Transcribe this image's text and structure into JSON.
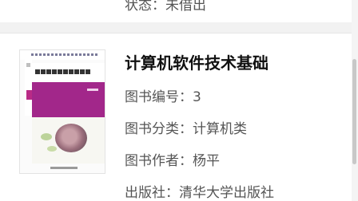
{
  "previous_item": {
    "status_label": "状态：",
    "status_value": "未借出"
  },
  "book": {
    "title": "计算机软件技术基础",
    "number_label": "图书编号：",
    "number_value": "3",
    "category_label": "图书分类：",
    "category_value": "计算机类",
    "author_label": "图书作者：",
    "author_value": "杨平",
    "publisher_label": "出版社：",
    "publisher_value": "清华大学出版社"
  },
  "colors": {
    "cover_accent": "#a2278a",
    "separator": "#f2f2f2",
    "text_secondary": "#555555"
  }
}
